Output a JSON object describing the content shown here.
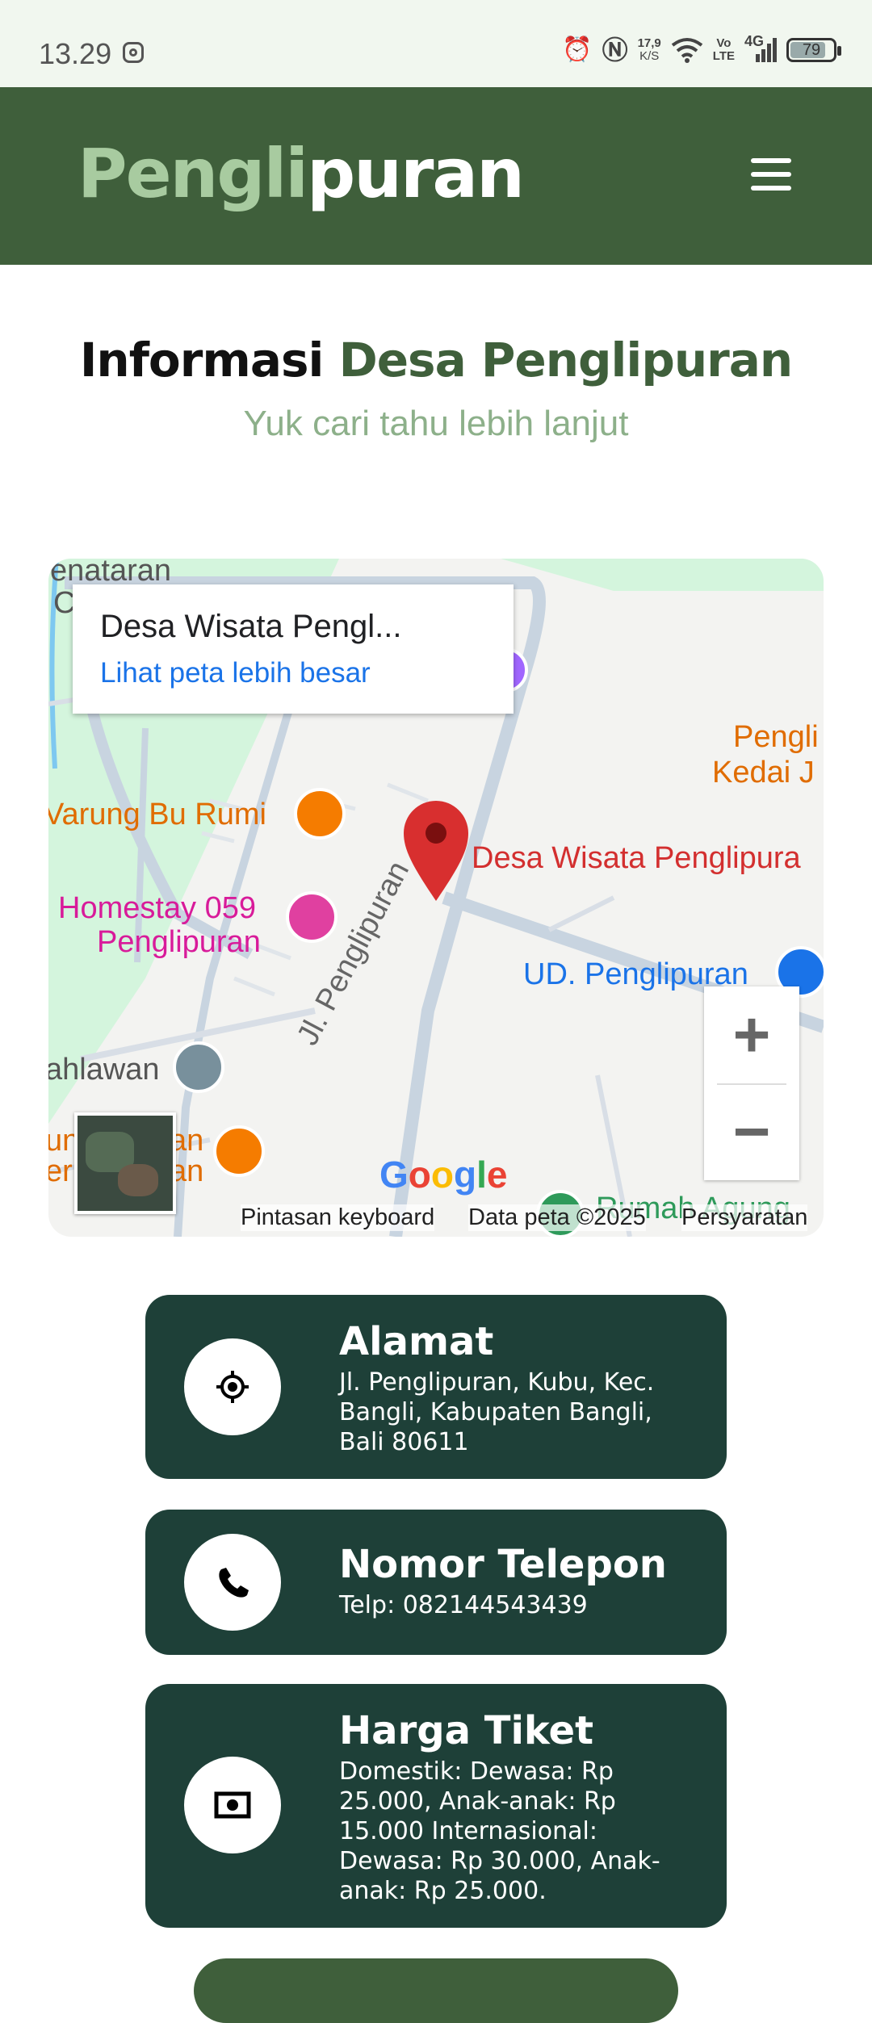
{
  "status_bar": {
    "time": "13.29",
    "net_speed_value": "17,9",
    "net_speed_unit": "K/S",
    "volte_top": "Vo",
    "volte_bottom": "LTE",
    "network": "4G",
    "battery": "79"
  },
  "header": {
    "logo_part1": "Pengli",
    "logo_part2": "puran",
    "menu_icon": "hamburger-icon"
  },
  "section": {
    "title_part1": "Informasi ",
    "title_part2": "Desa Penglipuran",
    "subtitle": "Yuk cari tahu lebih lanjut"
  },
  "map": {
    "card_title": "Desa Wisata Pengl...",
    "card_link": "Lihat peta lebih besar",
    "labels": {
      "enataran": "enataran",
      "c_fragment": "C",
      "pengli_kedai_1": "Pengli",
      "pengli_kedai_2": "Kedai J",
      "warung": "Varung Bu Rumi",
      "marker_label": "Desa Wisata Penglipura",
      "homestay_1": "Homestay 059",
      "homestay_2": "Penglipuran",
      "ud": "UD. Penglipuran",
      "street": "Jl. Penglipuran",
      "pahlawan": "ahlawan",
      "an_1": "an",
      "an_2": "an",
      "un": "un",
      "er": "er",
      "rumah_agung": "Rumah Agung"
    },
    "google": "Google",
    "zoom_in": "+",
    "zoom_out": "−",
    "footer_keyboard": "Pintasan keyboard",
    "footer_data": "Data peta ©2025",
    "footer_terms": "Persyaratan"
  },
  "info_cards": [
    {
      "icon": "location-target-icon",
      "heading": "Alamat",
      "text": "Jl. Penglipuran, Kubu, Kec. Bangli, Kabupaten Bangli, Bali 80611"
    },
    {
      "icon": "phone-icon",
      "heading": "Nomor Telepon",
      "text": "Telp: 082144543439"
    },
    {
      "icon": "money-icon",
      "heading": "Harga Tiket",
      "text": "Domestik: Dewasa: Rp 25.000, Anak-anak: Rp 15.000 Internasional: Dewasa: Rp 30.000, Anak-anak: Rp 25.000."
    }
  ],
  "colors": {
    "header_bg": "#3f5f3b",
    "logo_light": "#a8cba0",
    "card_bg": "#1e4038",
    "subtitle": "#8db08a",
    "link": "#1a73e8"
  }
}
